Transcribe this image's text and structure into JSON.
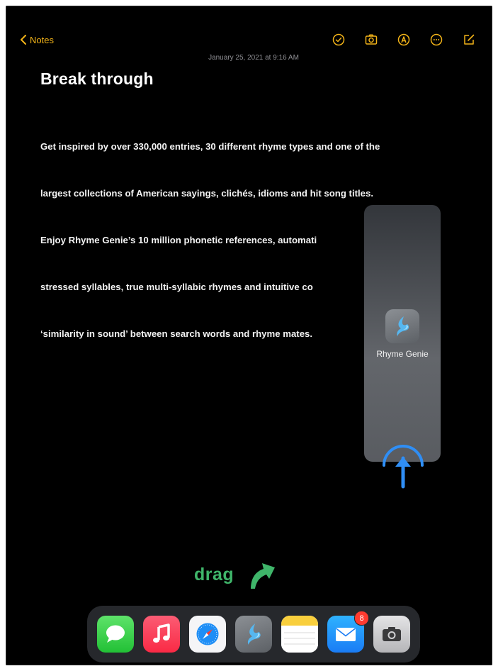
{
  "notes_nav": {
    "back_label": "Notes"
  },
  "toolbar": {
    "icons": [
      "checklist-icon",
      "camera-icon",
      "markup-icon",
      "more-icon",
      "compose-icon"
    ],
    "accent_color": "#f2b318"
  },
  "note": {
    "date": "January 25, 2021 at 9:16 AM",
    "title": "Break through",
    "lines": [
      "Get inspired by over 330,000 entries, 30 different rhyme types and one of the",
      "largest collections of American sayings, clichés, idioms and hit song titles.",
      "Enjoy Rhyme Genie’s 10 million phonetic references, automati",
      "stressed syllables, true multi-syllabic rhymes and intuitive co",
      "‘similarity in sound’ between search words and rhyme mates."
    ]
  },
  "slide_over": {
    "app_name": "Rhyme Genie",
    "app_icon": "rhyme-genie-icon"
  },
  "annotation": {
    "drag_label": "drag",
    "drag_color": "#3fb56a",
    "hint_color": "#2f8ef5"
  },
  "dock": {
    "apps": [
      {
        "icon": "messages-icon"
      },
      {
        "icon": "music-icon"
      },
      {
        "icon": "safari-icon"
      },
      {
        "icon": "rhyme-genie-icon"
      },
      {
        "icon": "notes-icon"
      },
      {
        "icon": "mail-icon",
        "badge": "8"
      },
      {
        "icon": "camera-icon"
      }
    ]
  }
}
